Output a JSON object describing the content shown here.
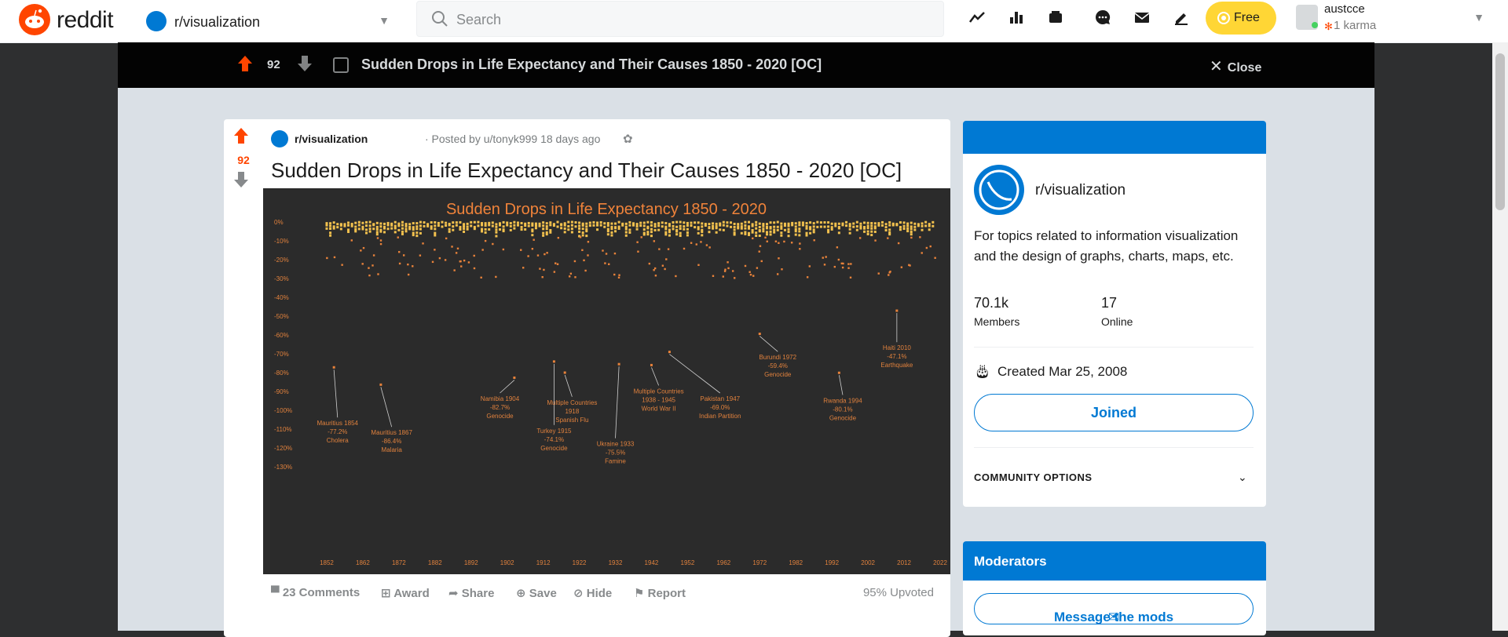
{
  "header": {
    "logo_text": "reddit",
    "community": "r/visualization",
    "search_placeholder": "Search",
    "free_label": "Free",
    "username": "austcce",
    "karma": "1 karma",
    "icons": [
      "trending-icon",
      "popular-icon",
      "media-icon",
      "chat-icon",
      "inbox-icon",
      "create-post-icon"
    ]
  },
  "post_bar": {
    "score": "92",
    "title": "Sudden Drops in Life Expectancy and Their Causes 1850 - 2020 [OC]",
    "close_label": "Close"
  },
  "post": {
    "score": "92",
    "subreddit": "r/visualization",
    "posted_by": "· Posted by u/tonyk999 18 days ago",
    "title": "Sudden Drops in Life Expectancy and Their Causes 1850 - 2020 [OC]",
    "actions": {
      "comments": "23 Comments",
      "award": "Award",
      "share": "Share",
      "save": "Save",
      "hide": "Hide",
      "report": "Report"
    },
    "upvoted": "95% Upvoted"
  },
  "chart_data": {
    "type": "scatter",
    "title": "Sudden Drops in Life Expectancy 1850 - 2020",
    "x_ticks": [
      "1852",
      "1862",
      "1872",
      "1882",
      "1892",
      "1902",
      "1912",
      "1922",
      "1932",
      "1942",
      "1952",
      "1962",
      "1972",
      "1982",
      "1992",
      "2002",
      "2012",
      "2022"
    ],
    "y_ticks": [
      "0%",
      "-10%",
      "-20%",
      "-30%",
      "-40%",
      "-50%",
      "-60%",
      "-70%",
      "-80%",
      "-90%",
      "-100%",
      "-110%",
      "-120%",
      "-130%"
    ],
    "xlim": [
      1847,
      2022
    ],
    "ylim": [
      -135,
      0
    ],
    "highlighted_events": [
      {
        "place": "Mauritius 1854",
        "value_label": "-77.2%",
        "cause": "Cholera",
        "x": 1854,
        "y": -77.2
      },
      {
        "place": "Mauritius 1867",
        "value_label": "-86.4%",
        "cause": "Malaria",
        "x": 1867,
        "y": -86.4
      },
      {
        "place": "Namibia 1904",
        "value_label": "-82.7%",
        "cause": "Genocide",
        "x": 1904,
        "y": -82.7
      },
      {
        "place": "Turkey 1915",
        "value_label": "-74.1%",
        "cause": "Genocide",
        "x": 1915,
        "y": -74.1
      },
      {
        "place": "Multiple Countries",
        "value_label": "1918",
        "cause": "Spanish Flu",
        "x": 1918,
        "y": -80
      },
      {
        "place": "Ukraine 1933",
        "value_label": "-75.5%",
        "cause": "Famine",
        "x": 1933,
        "y": -75.5
      },
      {
        "place": "Multiple Countries",
        "value_label": "1938 - 1945",
        "cause": "World War II",
        "x": 1942,
        "y": -76
      },
      {
        "place": "Pakistan 1947",
        "value_label": "-69.0%",
        "cause": "Indian Partition",
        "x": 1947,
        "y": -69.0
      },
      {
        "place": "Burundi 1972",
        "value_label": "-59.4%",
        "cause": "Genocide",
        "x": 1972,
        "y": -59.4
      },
      {
        "place": "Rwanda 1994",
        "value_label": "-80.1%",
        "cause": "Genocide",
        "x": 1994,
        "y": -80.1
      },
      {
        "place": "Haiti 2010",
        "value_label": "-47.1%",
        "cause": "Earthquake",
        "x": 2010,
        "y": -47.1
      }
    ],
    "grid": false,
    "colors": {
      "background": "#2b2b2b",
      "title": "#f0833a",
      "bins": "#f2c14e",
      "events": "#e8823a",
      "labels": "#e0813d"
    }
  },
  "sidebar": {
    "community_name": "r/visualization",
    "description": "For topics related to information visualization and the design of graphs, charts, maps, etc.",
    "members": "70.1k",
    "members_label": "Members",
    "online": "17",
    "online_label": "Online",
    "created": "Created Mar 25, 2008",
    "joined_label": "Joined",
    "community_options": "COMMUNITY OPTIONS"
  },
  "moderators": {
    "title": "Moderators",
    "message_label": "Message the mods"
  }
}
